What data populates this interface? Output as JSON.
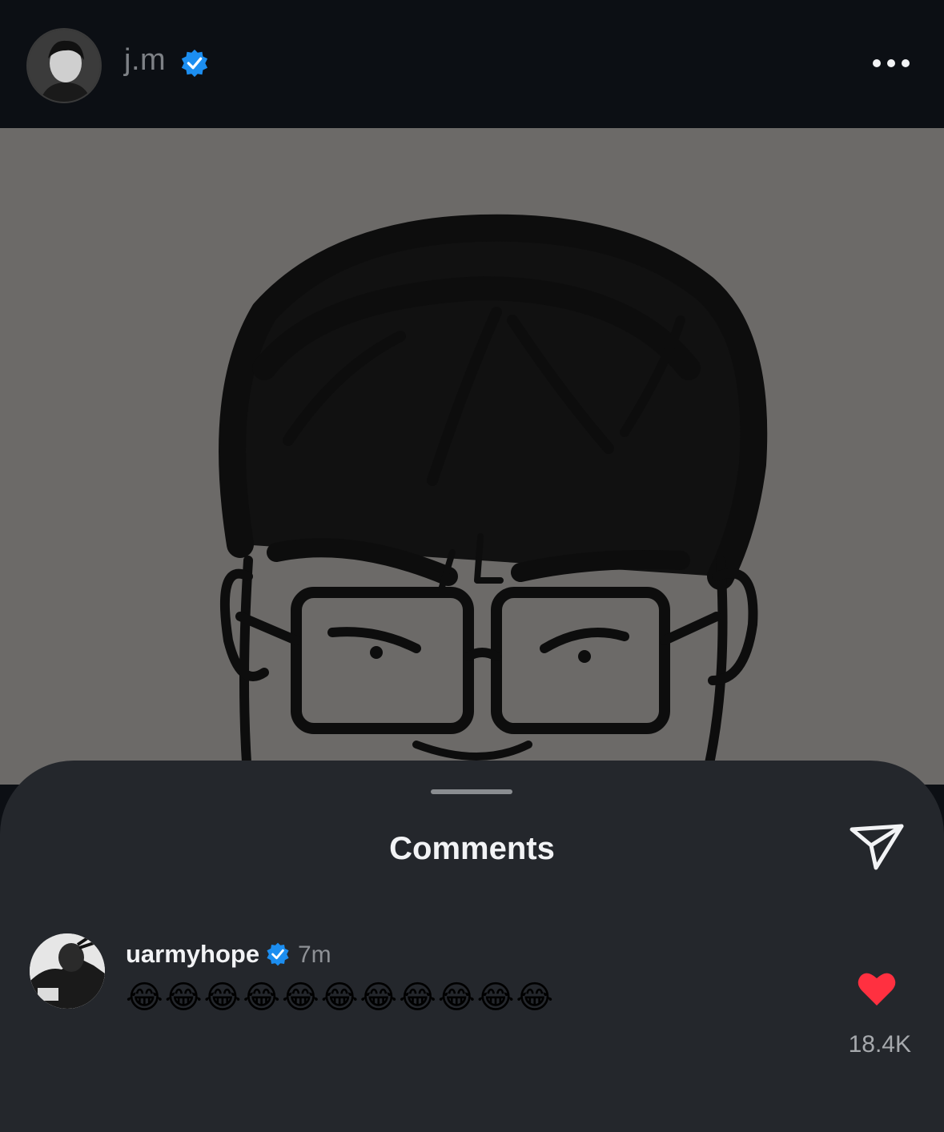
{
  "header": {
    "username": "j.m",
    "verified": true,
    "avatar_icon": "profile-photo-icon",
    "more_icon": "more-options-icon"
  },
  "post": {
    "image_icon": "caricature-drawing-image"
  },
  "comments_sheet": {
    "title": "Comments",
    "share_icon": "send-icon",
    "comments": [
      {
        "username": "uarmyhope",
        "verified": true,
        "time": "7m",
        "text": "😂😂😂😂😂😂😂😂😂😂😂",
        "liked": true,
        "like_count": "18.4K"
      }
    ]
  },
  "colors": {
    "background": "#0c0f14",
    "sheet": "#24272c",
    "verified_blue": "#1c8ef0",
    "like_red": "#ff3040",
    "photo_gray": "#6c6a68"
  }
}
